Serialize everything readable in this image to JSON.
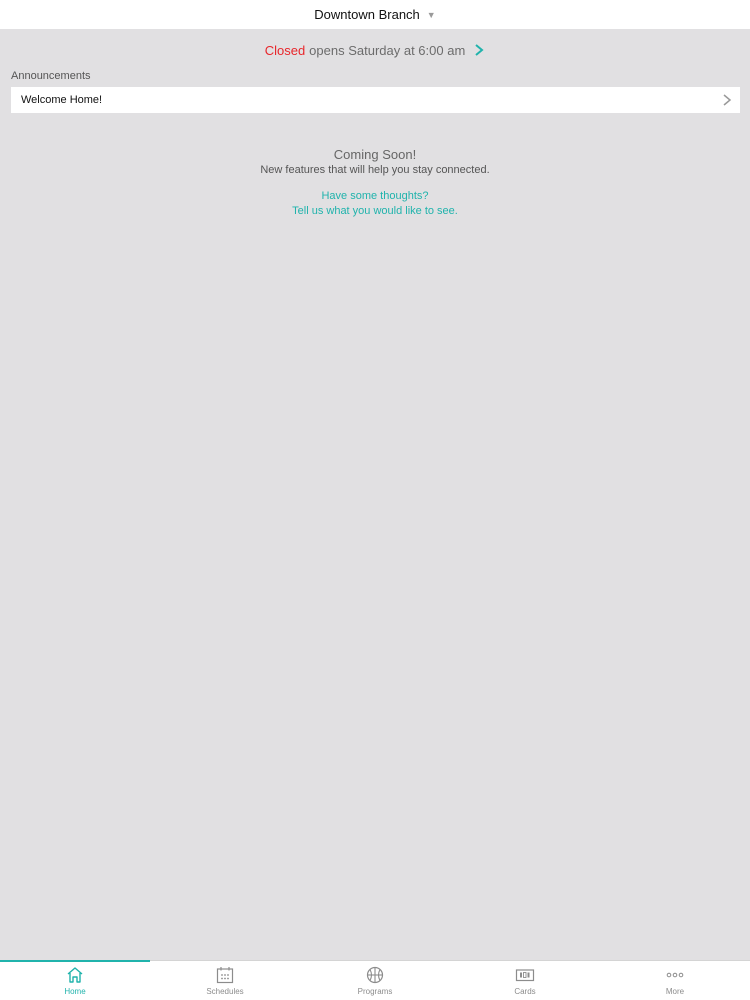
{
  "header": {
    "title": "Downtown Branch"
  },
  "status": {
    "state": "Closed",
    "detail": "opens Saturday at 6:00 am"
  },
  "announcements": {
    "section_label": "Announcements",
    "items": [
      {
        "label": "Welcome Home!"
      }
    ]
  },
  "coming_soon": {
    "title": "Coming Soon!",
    "subtitle": "New features that will help you stay connected.",
    "feedback_line1": "Have some thoughts?",
    "feedback_line2": "Tell us what you would like to see."
  },
  "tabbar": {
    "tabs": [
      {
        "label": "Home",
        "icon": "home-icon",
        "active": true
      },
      {
        "label": "Schedules",
        "icon": "calendar-icon",
        "active": false
      },
      {
        "label": "Programs",
        "icon": "basketball-icon",
        "active": false
      },
      {
        "label": "Cards",
        "icon": "card-icon",
        "active": false
      },
      {
        "label": "More",
        "icon": "more-icon",
        "active": false
      }
    ]
  },
  "colors": {
    "accent": "#20b3ac",
    "closed": "#e8262b",
    "background": "#e1e0e2"
  }
}
